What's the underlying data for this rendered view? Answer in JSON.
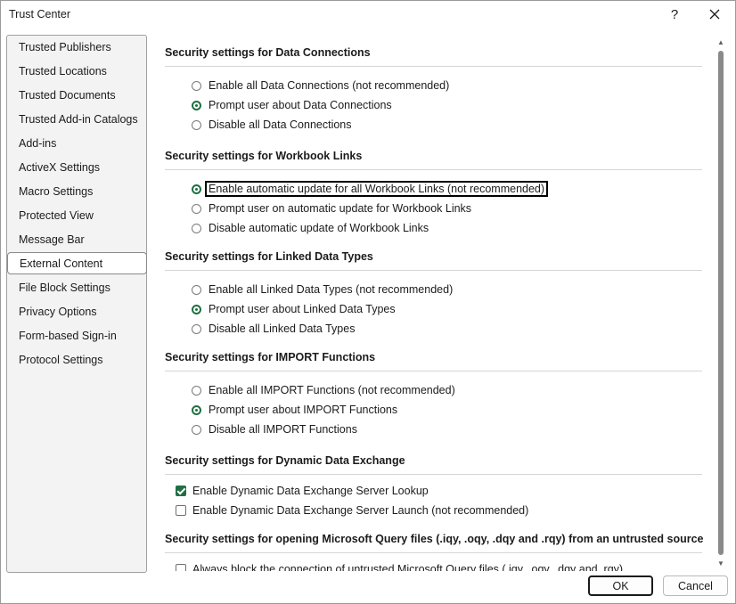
{
  "window": {
    "title": "Trust Center",
    "help_glyph": "?"
  },
  "sidebar": {
    "items": [
      {
        "label": "Trusted Publishers"
      },
      {
        "label": "Trusted Locations"
      },
      {
        "label": "Trusted Documents"
      },
      {
        "label": "Trusted Add-in Catalogs"
      },
      {
        "label": "Add-ins"
      },
      {
        "label": "ActiveX Settings"
      },
      {
        "label": "Macro Settings"
      },
      {
        "label": "Protected View"
      },
      {
        "label": "Message Bar"
      },
      {
        "label": "External Content",
        "selected": true
      },
      {
        "label": "File Block Settings"
      },
      {
        "label": "Privacy Options"
      },
      {
        "label": "Form-based Sign-in"
      },
      {
        "label": "Protocol Settings"
      }
    ]
  },
  "sections": {
    "data_connections": {
      "title": "Security settings for Data Connections",
      "options": [
        {
          "label": "Enable all Data Connections (not recommended)",
          "checked": false
        },
        {
          "label": "Prompt user about Data Connections",
          "checked": true
        },
        {
          "label": "Disable all Data Connections",
          "checked": false
        }
      ]
    },
    "workbook_links": {
      "title": "Security settings for Workbook Links",
      "options": [
        {
          "label": "Enable automatic update for all Workbook Links (not recommended)",
          "checked": true,
          "focused": true
        },
        {
          "label": "Prompt user on automatic update for Workbook Links",
          "checked": false
        },
        {
          "label": "Disable automatic update of Workbook Links",
          "checked": false
        }
      ]
    },
    "linked_data_types": {
      "title": "Security settings for Linked Data Types",
      "options": [
        {
          "label": "Enable all Linked Data Types (not recommended)",
          "checked": false
        },
        {
          "label": "Prompt user about Linked Data Types",
          "checked": true
        },
        {
          "label": "Disable all Linked Data Types",
          "checked": false
        }
      ]
    },
    "import_functions": {
      "title": "Security settings for IMPORT Functions",
      "options": [
        {
          "label": "Enable all IMPORT Functions (not recommended)",
          "checked": false
        },
        {
          "label": "Prompt user about IMPORT Functions",
          "checked": true
        },
        {
          "label": "Disable all IMPORT Functions",
          "checked": false
        }
      ]
    },
    "dde": {
      "title": "Security settings for Dynamic Data Exchange",
      "options": [
        {
          "label": "Enable Dynamic Data Exchange Server Lookup",
          "checked": true
        },
        {
          "label": "Enable Dynamic Data Exchange Server Launch (not recommended)",
          "checked": false
        }
      ]
    },
    "query_files": {
      "title": "Security settings for opening  Microsoft Query files (.iqy, .oqy, .dqy and .rqy) from an untrusted source",
      "options": [
        {
          "label": "Always block the connection of untrusted Microsoft Query files (.iqy, .oqy, .dqy and .rqy)",
          "checked": false
        }
      ]
    }
  },
  "buttons": {
    "ok": "OK",
    "cancel": "Cancel"
  },
  "colors": {
    "accent": "#1f6f43"
  }
}
